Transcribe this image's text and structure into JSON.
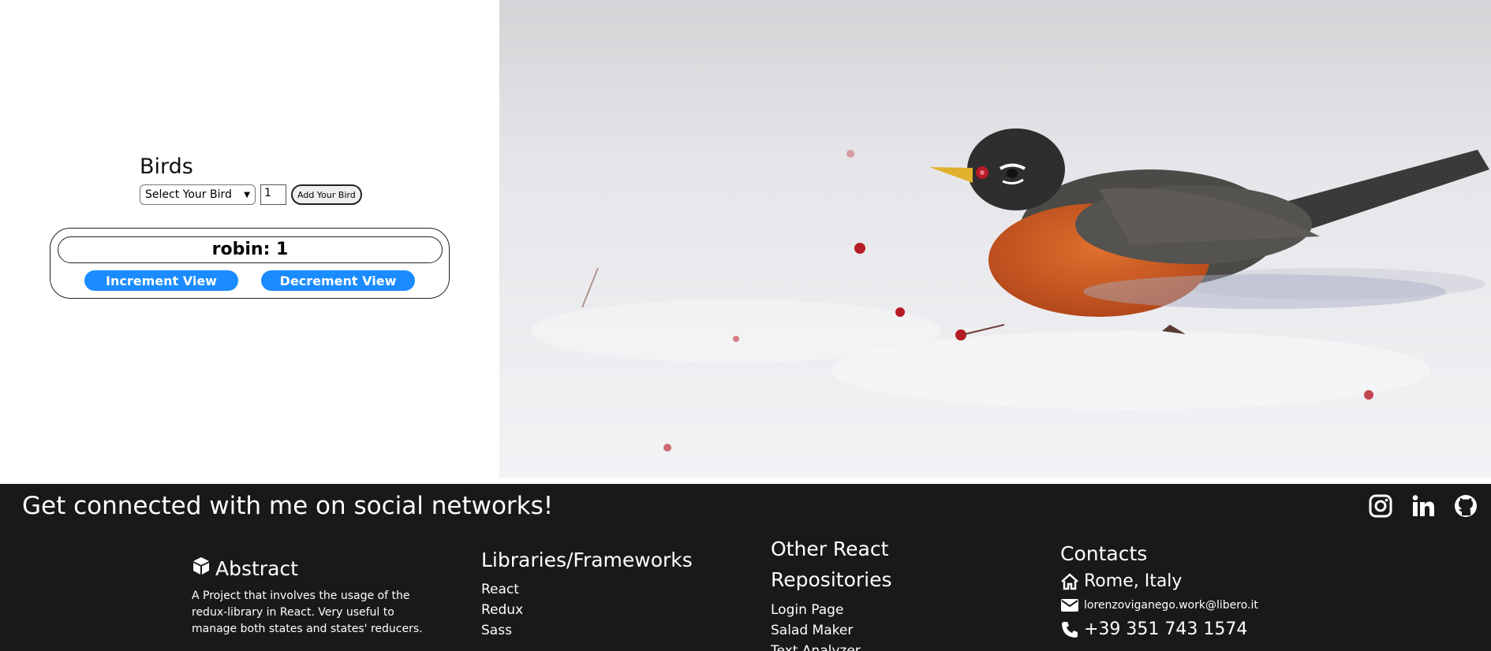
{
  "birds": {
    "title": "Birds",
    "select_placeholder": "Select Your Bird",
    "quantity_value": "1",
    "add_button_label": "Add Your Bird"
  },
  "card": {
    "label": "robin: 1",
    "increment_label": "Increment View",
    "decrement_label": "Decrement View"
  },
  "colors": {
    "accent_blue": "#1a8cff",
    "footer_bg": "#191919"
  },
  "footer": {
    "headline": "Get connected with me on social networks!",
    "socials": [
      "instagram-icon",
      "linkedin-icon",
      "github-icon"
    ],
    "abstract": {
      "title": "Abstract",
      "text": "A Project that involves the usage of the redux-library in React. Very useful to manage both states and states' reducers."
    },
    "libraries": {
      "title": "Libraries/Frameworks",
      "items": [
        "React",
        "Redux",
        "Sass"
      ]
    },
    "repos": {
      "title": "Other React Repositories",
      "items": [
        "Login Page",
        "Salad Maker",
        "Text Analyzer"
      ]
    },
    "contacts": {
      "title": "Contacts",
      "location": "Rome, Italy",
      "email": "lorenzoviganego.work@libero.it",
      "phone": "+39 351 743 1574"
    }
  }
}
